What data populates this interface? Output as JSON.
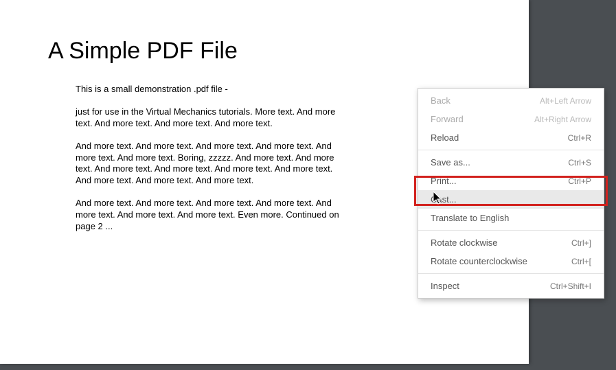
{
  "document": {
    "title": "A Simple PDF File",
    "paragraphs": [
      "This is a small demonstration .pdf file -",
      "just for use in the Virtual Mechanics tutorials. More text. And more text. And more text. And more text. And more text.",
      "And more text. And more text. And more text. And more text. And more text. And more text. Boring, zzzzz. And more text. And more text. And more text. And more text. And more text. And more text. And more text. And more text. And more text.",
      "And more text. And more text. And more text. And more text. And more text. And more text. And more text. Even more. Continued on page 2 ..."
    ]
  },
  "contextMenu": {
    "items": [
      {
        "label": "Back",
        "shortcut": "Alt+Left Arrow",
        "disabled": true
      },
      {
        "label": "Forward",
        "shortcut": "Alt+Right Arrow",
        "disabled": true
      },
      {
        "label": "Reload",
        "shortcut": "Ctrl+R"
      },
      {
        "sep": true
      },
      {
        "label": "Save as...",
        "shortcut": "Ctrl+S"
      },
      {
        "label": "Print...",
        "shortcut": "Ctrl+P"
      },
      {
        "label": "Cast...",
        "shortcut": "",
        "hover": true
      },
      {
        "label": "Translate to English",
        "shortcut": ""
      },
      {
        "sep": true
      },
      {
        "label": "Rotate clockwise",
        "shortcut": "Ctrl+]"
      },
      {
        "label": "Rotate counterclockwise",
        "shortcut": "Ctrl+["
      },
      {
        "sep": true
      },
      {
        "label": "Inspect",
        "shortcut": "Ctrl+Shift+I"
      }
    ]
  }
}
